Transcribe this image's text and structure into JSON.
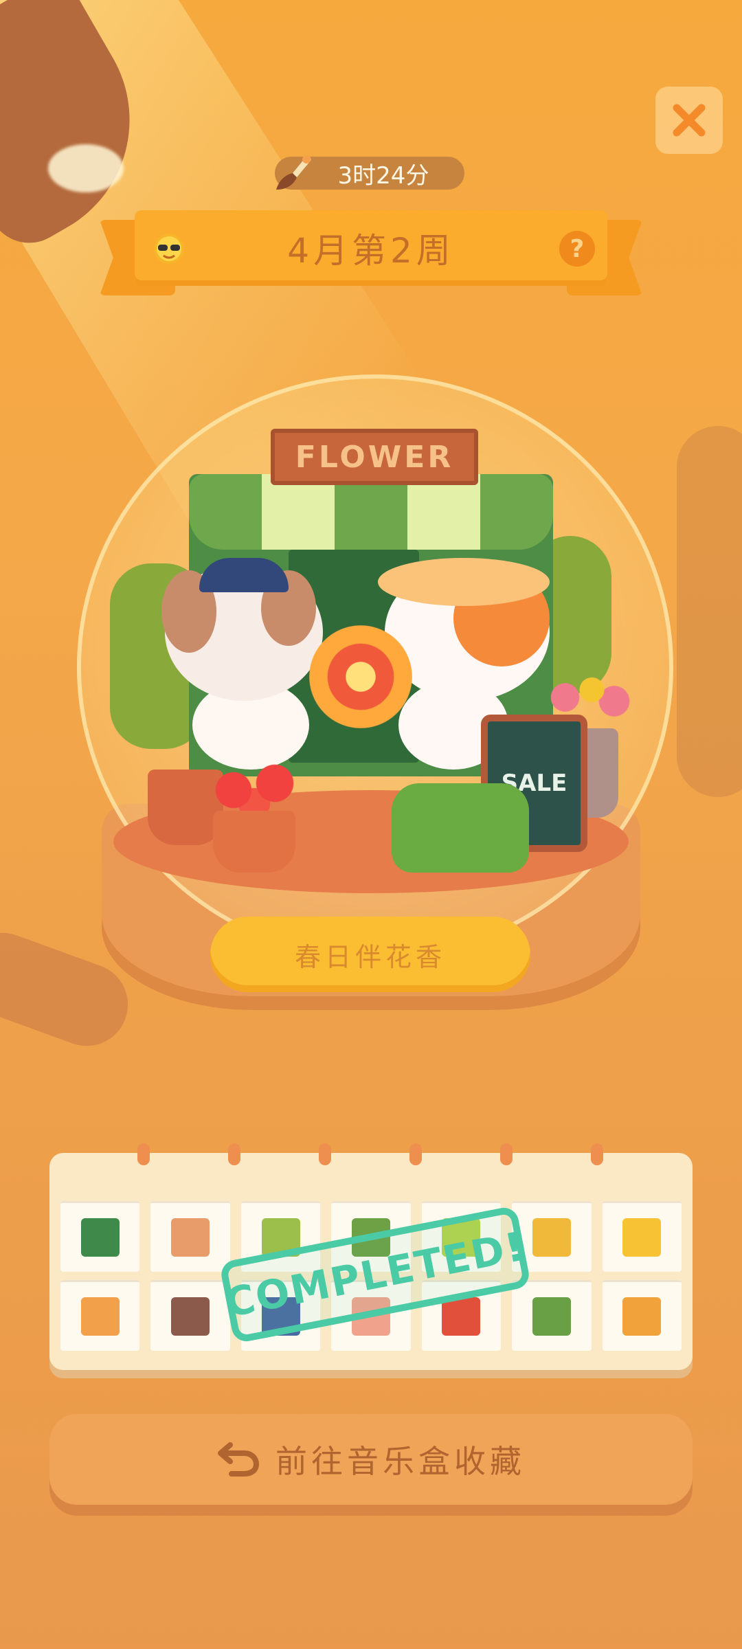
{
  "timer": {
    "text": "3时24分",
    "icon": "paintbrush-icon"
  },
  "banner": {
    "title": "4月第2周",
    "left_icon": "sun-sunglasses-icon",
    "right_icon": "help-icon",
    "help_glyph": "?"
  },
  "close": {
    "icon": "close-icon"
  },
  "scene": {
    "shop_sign": "FLOWER",
    "chalkboard": "SALE",
    "plaque": "春日伴花香"
  },
  "calendar": {
    "stamp": "COMPLETED!",
    "rows": [
      [
        {
          "item": "green-lantern-icon",
          "color": "#3f8a4a"
        },
        {
          "item": "flower-bouquet-icon",
          "color": "#e79c6a"
        },
        {
          "item": "cactus-icon",
          "color": "#9bbf4a"
        },
        {
          "item": "potted-plant-icon",
          "color": "#6ea045"
        },
        {
          "item": "frog-icon",
          "color": "#b6d24a"
        },
        {
          "item": "bee-icon",
          "color": "#f1b93a"
        },
        {
          "item": "yellow-flower-icon",
          "color": "#f7c233"
        }
      ],
      [
        {
          "item": "cat-face-icon",
          "color": "#f2a04a"
        },
        {
          "item": "bear-icon",
          "color": "#8b5a4a"
        },
        {
          "item": "dog-officer-icon",
          "color": "#4a6aa0"
        },
        {
          "item": "basket-icon",
          "color": "#f0a28c"
        },
        {
          "item": "red-flower-icon",
          "color": "#e0503a"
        },
        {
          "item": "green-bench-icon",
          "color": "#6aa045"
        },
        {
          "item": "wreath-icon",
          "color": "#f2a23a"
        }
      ]
    ]
  },
  "goto_button": {
    "label": "前往音乐盒收藏",
    "icon": "return-arrow-icon"
  },
  "colors": {
    "background": "#f4a849",
    "banner": "#fbac2c",
    "stamp": "#4bcaa6",
    "button": "#f0a458"
  }
}
